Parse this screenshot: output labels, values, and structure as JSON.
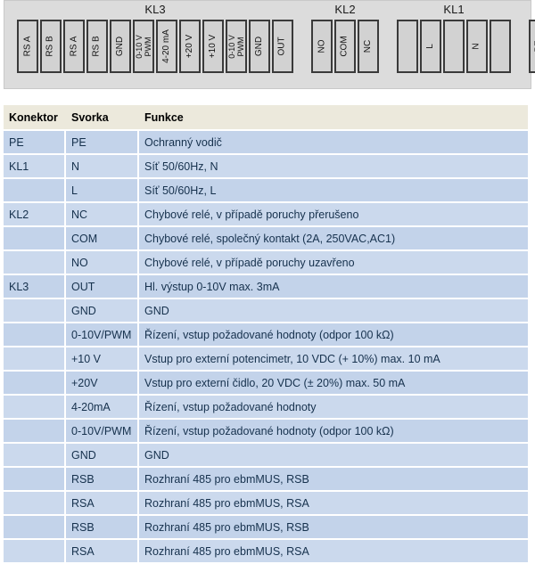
{
  "diagram": {
    "groups": [
      {
        "name": "KL3",
        "label": "KL3"
      },
      {
        "name": "KL2",
        "label": "KL2"
      },
      {
        "name": "KL1",
        "label": "KL1"
      }
    ],
    "terminals": [
      {
        "id": "t1",
        "label": "RS A",
        "group": "KL3"
      },
      {
        "id": "t2",
        "label": "RS B",
        "group": "KL3"
      },
      {
        "id": "t3",
        "label": "RS A",
        "group": "KL3"
      },
      {
        "id": "t4",
        "label": "RS B",
        "group": "KL3"
      },
      {
        "id": "t5",
        "label": "GND",
        "group": "KL3"
      },
      {
        "id": "t6",
        "label": "0-10 V\nPWM",
        "group": "KL3"
      },
      {
        "id": "t7",
        "label": "4-20 mA",
        "group": "KL3"
      },
      {
        "id": "t8",
        "label": "+20 V",
        "group": "KL3"
      },
      {
        "id": "t9",
        "label": "+10 V",
        "group": "KL3"
      },
      {
        "id": "t10",
        "label": "0-10 V\nPWM",
        "group": "KL3"
      },
      {
        "id": "t11",
        "label": "GND",
        "group": "KL3"
      },
      {
        "id": "t12",
        "label": "OUT",
        "group": "KL3"
      },
      {
        "id": "t13",
        "label": "NO",
        "group": "KL2"
      },
      {
        "id": "t14",
        "label": "COM",
        "group": "KL2"
      },
      {
        "id": "t15",
        "label": "NC",
        "group": "KL2"
      },
      {
        "id": "t16",
        "label": "",
        "group": "KL1"
      },
      {
        "id": "t17",
        "label": "L",
        "group": "KL1"
      },
      {
        "id": "t18",
        "label": "",
        "group": "KL1"
      },
      {
        "id": "t19",
        "label": "N",
        "group": "KL1"
      },
      {
        "id": "t20",
        "label": "",
        "group": "KL1"
      },
      {
        "id": "t21",
        "label": "PE",
        "group": "PE"
      }
    ]
  },
  "table": {
    "headers": {
      "konektor": "Konektor",
      "svorka": "Svorka",
      "funkce": "Funkce"
    },
    "rows": [
      {
        "konektor": "PE",
        "svorka": "PE",
        "funkce": "Ochranný vodič"
      },
      {
        "konektor": "KL1",
        "svorka": "N",
        "funkce": "Síť 50/60Hz, N"
      },
      {
        "konektor": "",
        "svorka": "L",
        "funkce": "Síť 50/60Hz, L"
      },
      {
        "konektor": "KL2",
        "svorka": "NC",
        "funkce": "Chybové relé, v případě poruchy přerušeno"
      },
      {
        "konektor": "",
        "svorka": "COM",
        "funkce": "Chybové relé, společný kontakt (2A, 250VAC,AC1)"
      },
      {
        "konektor": "",
        "svorka": "NO",
        "funkce": "Chybové relé, v případě poruchy uzavřeno"
      },
      {
        "konektor": "KL3",
        "svorka": "OUT",
        "funkce": "Hl. výstup 0-10V max. 3mA"
      },
      {
        "konektor": "",
        "svorka": "GND",
        "funkce": "GND"
      },
      {
        "konektor": "",
        "svorka": "0-10V/PWM",
        "funkce": "Řízení, vstup požadované hodnoty (odpor 100 kΩ)"
      },
      {
        "konektor": "",
        "svorka": "+10 V",
        "funkce": "Vstup pro externí potencimetr, 10 VDC (+ 10%) max. 10 mA"
      },
      {
        "konektor": "",
        "svorka": "+20V",
        "funkce": "Vstup pro externí čidlo, 20 VDC (± 20%) max. 50 mA"
      },
      {
        "konektor": "",
        "svorka": "4-20mA",
        "funkce": "Řízení, vstup požadované hodnoty"
      },
      {
        "konektor": "",
        "svorka": "0-10V/PWM",
        "funkce": "Řízení, vstup požadované hodnoty (odpor 100 kΩ)"
      },
      {
        "konektor": "",
        "svorka": "GND",
        "funkce": "GND"
      },
      {
        "konektor": "",
        "svorka": "RSB",
        "funkce": "Rozhraní 485 pro ebmMUS, RSB"
      },
      {
        "konektor": "",
        "svorka": "RSA",
        "funkce": "Rozhraní 485 pro ebmMUS, RSA"
      },
      {
        "konektor": "",
        "svorka": "RSB",
        "funkce": "Rozhraní 485 pro ebmMUS, RSB"
      },
      {
        "konektor": "",
        "svorka": "RSA",
        "funkce": "Rozhraní 485 pro ebmMUS, RSA"
      }
    ]
  },
  "colors": {
    "panel_background": "#dcdcdc",
    "terminal_fill": "#d2d2d2",
    "terminal_border": "#3a3a3a",
    "table_header_bg": "#ece9dc",
    "table_row_bg": "#c3d3ea",
    "table_row_alt_bg": "#cbd9ed",
    "table_text": "#16314d"
  }
}
